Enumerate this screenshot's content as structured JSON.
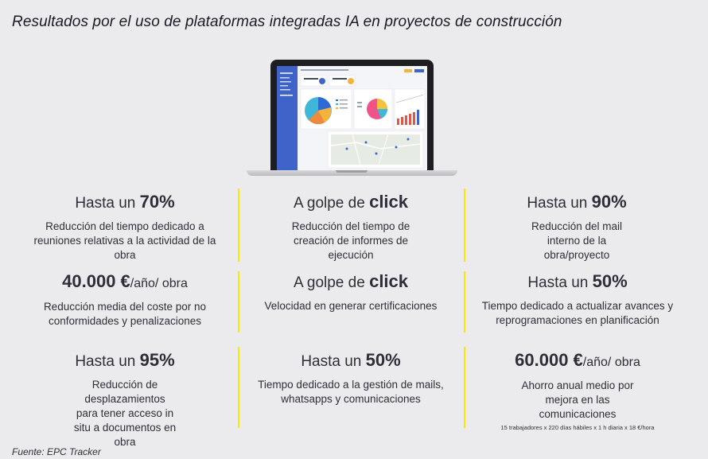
{
  "title": "Resultados por el uso de plataformas integradas IA en proyectos de construcción",
  "source": "Fuente: EPC Tracker",
  "colors": {
    "accent": "#ffe600",
    "text": "#2e2e38",
    "background": "#ebebed"
  },
  "stats": [
    {
      "pre": "Hasta un ",
      "big": "70%",
      "post": "",
      "desc": "Reducción del tiempo dedicado a reuniones relativas a la actividad de la obra"
    },
    {
      "pre": "A golpe de ",
      "big": "click",
      "post": "",
      "desc": "Reducción del tiempo de creación de informes de ejecución"
    },
    {
      "pre": "Hasta un ",
      "big": "90%",
      "post": "",
      "desc": "Reducción del mail interno de la obra/proyecto"
    },
    {
      "pre": "",
      "big": "40.000 €",
      "post": "/año/ obra",
      "desc": "Reducción media del coste por no conformidades y penalizaciones"
    },
    {
      "pre": "A golpe de ",
      "big": "click",
      "post": "",
      "desc": "Velocidad en generar certificaciones"
    },
    {
      "pre": "Hasta un ",
      "big": "50%",
      "post": "",
      "desc": "Tiempo dedicado a actualizar avances y reprogramaciones en planificación"
    },
    {
      "pre": "Hasta un ",
      "big": "95%",
      "post": "",
      "desc": "Reducción de desplazamientos para tener acceso in situ a documentos en obra"
    },
    {
      "pre": "Hasta un ",
      "big": "50%",
      "post": "",
      "desc": "Tiempo dedicado a la gestión de mails, whatsapps y comunicaciones"
    },
    {
      "pre": "",
      "big": "60.000 €",
      "post": "/año/ obra",
      "desc": "Ahorro anual medio por mejora en las comunicaciones",
      "note": "15 trabajadores x 220 días hábiles x 1 h diaria x 18 €/hora"
    }
  ]
}
